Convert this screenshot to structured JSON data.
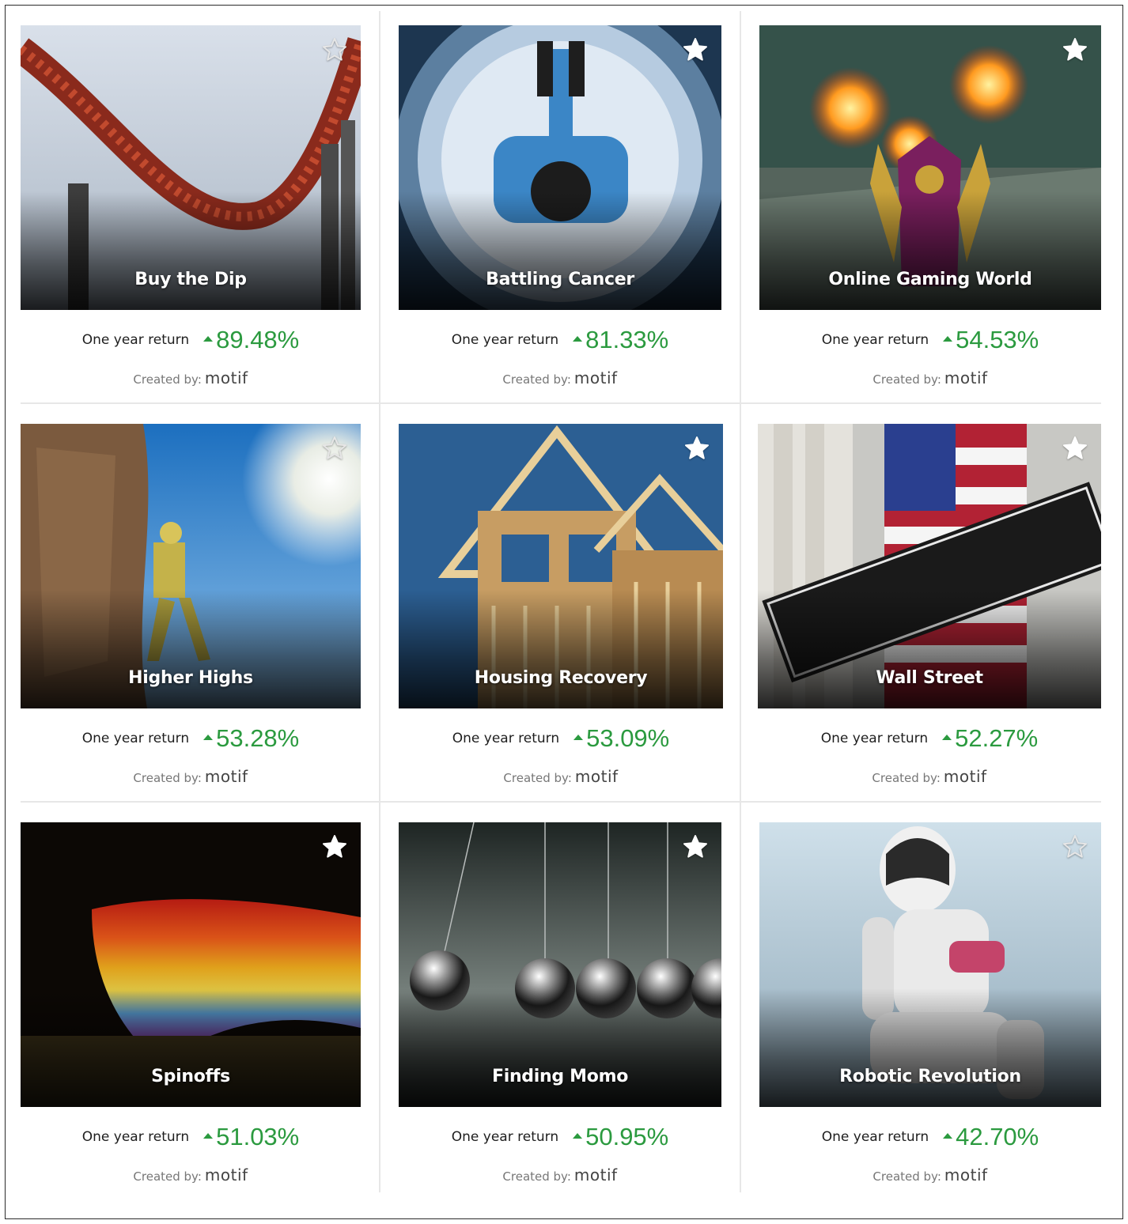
{
  "labels": {
    "return_label": "One year return",
    "creator_label": "Created by:",
    "creator_brand": "motif"
  },
  "colors": {
    "positive": "#2b9a3f",
    "divider": "#e7e7e7"
  },
  "motifs": [
    {
      "title": "Buy the Dip",
      "return": "89.48%",
      "starred": false,
      "art": "roller-coaster"
    },
    {
      "title": "Battling Cancer",
      "return": "81.33%",
      "starred": true,
      "art": "mri-scanner"
    },
    {
      "title": "Online Gaming World",
      "return": "54.53%",
      "starred": true,
      "art": "game-wizard"
    },
    {
      "title": "Higher Highs",
      "return": "53.28%",
      "starred": false,
      "art": "rock-climber"
    },
    {
      "title": "Housing Recovery",
      "return": "53.09%",
      "starred": true,
      "art": "house-framing"
    },
    {
      "title": "Wall Street",
      "return": "52.27%",
      "starred": true,
      "art": "wall-street-sign"
    },
    {
      "title": "Spinoffs",
      "return": "51.03%",
      "starred": true,
      "art": "spinning-top"
    },
    {
      "title": "Finding Momo",
      "return": "50.95%",
      "starred": true,
      "art": "newtons-cradle"
    },
    {
      "title": "Robotic Revolution",
      "return": "42.70%",
      "starred": false,
      "art": "thinking-robot"
    }
  ]
}
